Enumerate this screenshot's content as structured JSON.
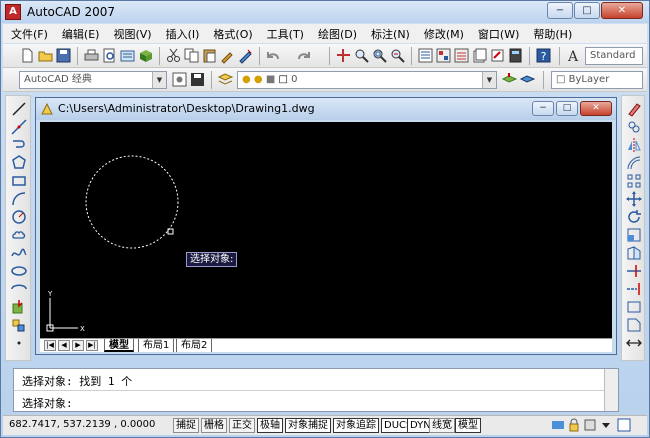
{
  "app": {
    "title": "AutoCAD 2007",
    "icon": "A"
  },
  "window_buttons": {
    "minimize": "−",
    "maximize": "□",
    "close": "✕"
  },
  "menu": [
    "文件(F)",
    "编辑(E)",
    "视图(V)",
    "插入(I)",
    "格式(O)",
    "工具(T)",
    "绘图(D)",
    "标注(N)",
    "修改(M)",
    "窗口(W)",
    "帮助(H)"
  ],
  "toolbar": {
    "text_style": "Standard",
    "workspace": "AutoCAD 经典",
    "layer": "0",
    "color": "ByLayer"
  },
  "drawing": {
    "title": "C:\\Users\\Administrator\\Desktop\\Drawing1.dwg",
    "tabs": [
      "模型",
      "布局1",
      "布局2"
    ],
    "active_tab": "模型",
    "tooltip": "选择对象:",
    "ucs_x": "X",
    "ucs_y": "Y"
  },
  "command": {
    "line1": "选择对象: 找到 1 个",
    "line2": "选择对象:"
  },
  "status": {
    "coords": "682.7417,  537.2139 , 0.0000",
    "buttons": [
      "捕捉",
      "栅格",
      "正交",
      "极轴",
      "对象捕捉",
      "对象追踪",
      "DUCS",
      "DYN",
      "线宽",
      "模型"
    ],
    "on_buttons": [
      "极轴",
      "对象捕捉",
      "对象追踪",
      "DUCS",
      "DYN",
      "模型"
    ]
  },
  "colors": {
    "canvas": "#000000",
    "selection_dash": "#ffffff",
    "title_gradient": "#bcd3ee"
  }
}
